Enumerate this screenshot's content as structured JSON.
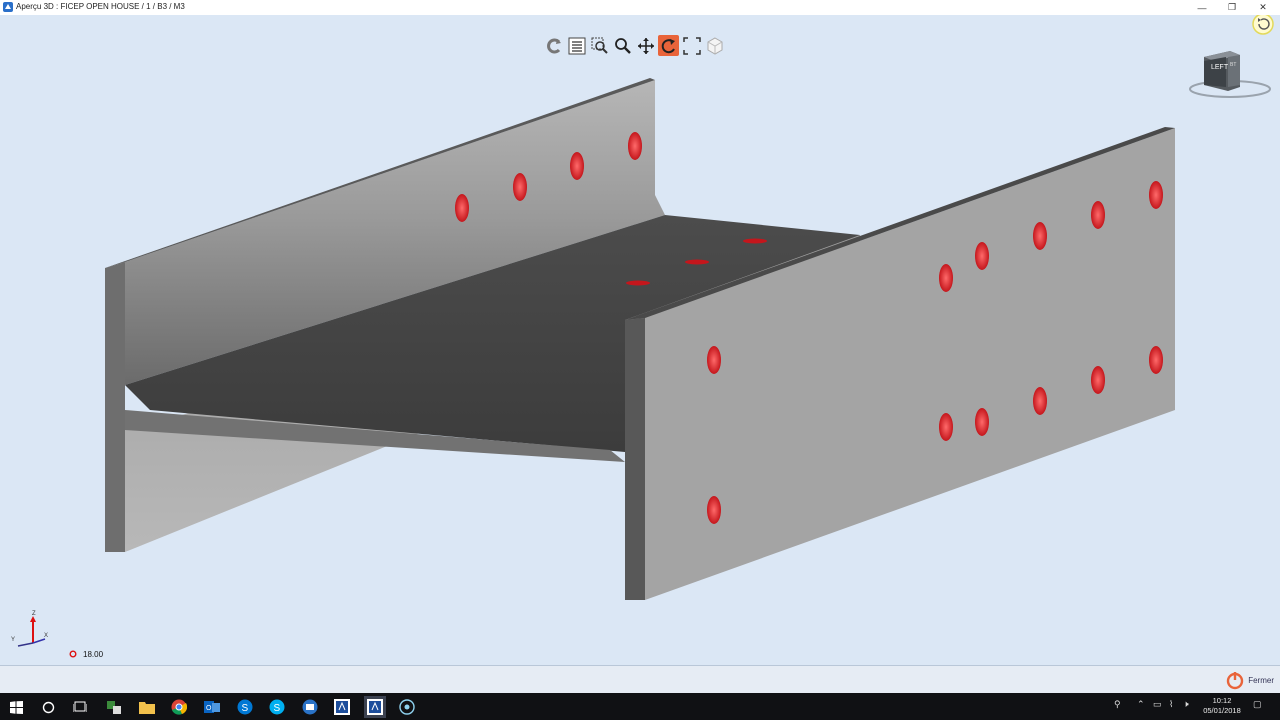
{
  "window": {
    "title": "Aperçu 3D : FICEP OPEN HOUSE / 1 / B3 / M3",
    "minimize": "—",
    "restore": "❐",
    "close": "✕"
  },
  "toolbar": {
    "tools": [
      {
        "name": "refresh-icon",
        "active": false
      },
      {
        "name": "list-icon",
        "active": false
      },
      {
        "name": "zoom-window-icon",
        "active": false
      },
      {
        "name": "zoom-icon",
        "active": false
      },
      {
        "name": "pan-icon",
        "active": false
      },
      {
        "name": "rotate-icon",
        "active": true
      },
      {
        "name": "fit-icon",
        "active": false
      },
      {
        "name": "cube-view-icon",
        "active": false
      }
    ]
  },
  "viewcube": {
    "face_left": "LEFT",
    "face_back": "BT"
  },
  "axes": {
    "z": "Z",
    "x": "X",
    "y": "Y"
  },
  "scale": {
    "value": "18.00"
  },
  "statusbar": {
    "close_label": "Fermer"
  },
  "taskbar": {
    "time": "10:12",
    "date": "05/01/2018",
    "apps": [
      "start-icon",
      "search-icon",
      "task-view-icon",
      "network-app-icon",
      "file-explorer-icon",
      "chrome-icon",
      "outlook-icon",
      "skype-business-icon",
      "skype-icon",
      "remote-desktop-icon",
      "app-window-icon",
      "app-window-active-icon",
      "record-icon"
    ]
  },
  "colors": {
    "accent": "#e9643a",
    "viewport": "#dbe7f5",
    "steel": "#8d8d8d",
    "hole": "#e0262c"
  }
}
